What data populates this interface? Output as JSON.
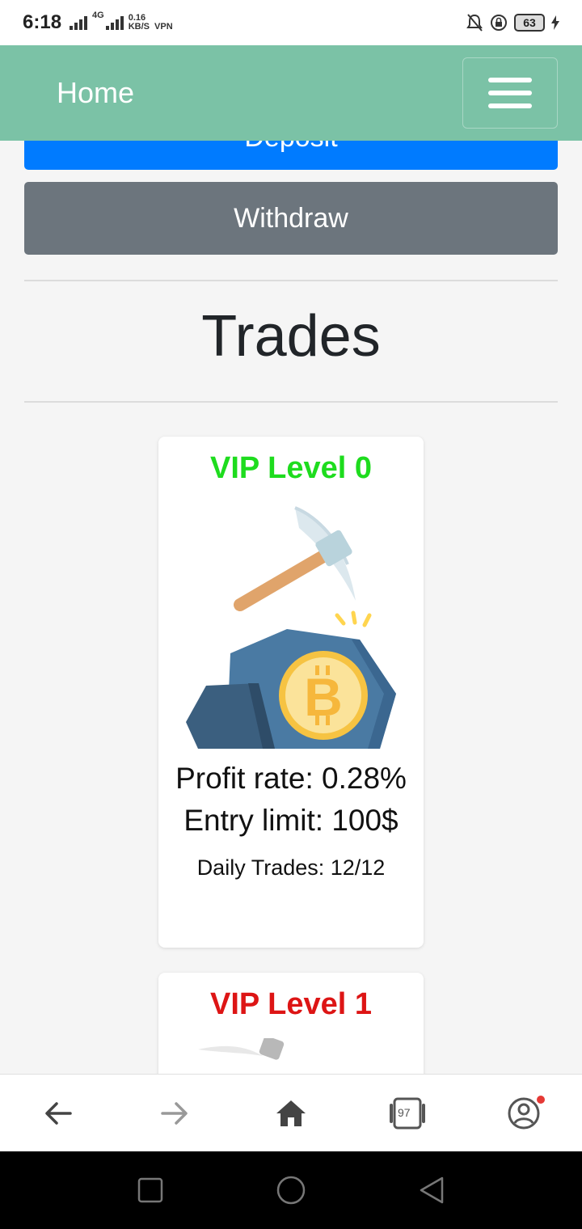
{
  "status_bar": {
    "time": "6:18",
    "network_type": "4G",
    "speed_value": "0.16",
    "speed_unit": "KB/S",
    "vpn_label": "VPN",
    "battery_level": "63"
  },
  "navbar": {
    "brand": "Home",
    "menu_icon": "hamburger-icon",
    "color": "#7bc2a6"
  },
  "actions": {
    "deposit_label": "Deposit",
    "withdraw_label": "Withdraw"
  },
  "section": {
    "title": "Trades"
  },
  "cards": [
    {
      "title": "VIP Level 0",
      "title_color": "#1edc1e",
      "image_icon": "bitcoin-mining-icon",
      "profit_rate": "Profit rate: 0.28%",
      "entry_limit": "Entry limit: 100$",
      "daily_trades": "Daily Trades: 12/12"
    },
    {
      "title": "VIP Level 1",
      "title_color": "#dd1515",
      "image_icon": "pickaxe-icon"
    }
  ],
  "browser_bar": {
    "tab_count": "97",
    "icons": [
      "back-arrow-icon",
      "forward-arrow-icon",
      "home-icon",
      "tabs-icon",
      "account-icon"
    ]
  },
  "system_nav": {
    "icons": [
      "recents-icon",
      "home-circle-icon",
      "back-triangle-icon"
    ]
  }
}
